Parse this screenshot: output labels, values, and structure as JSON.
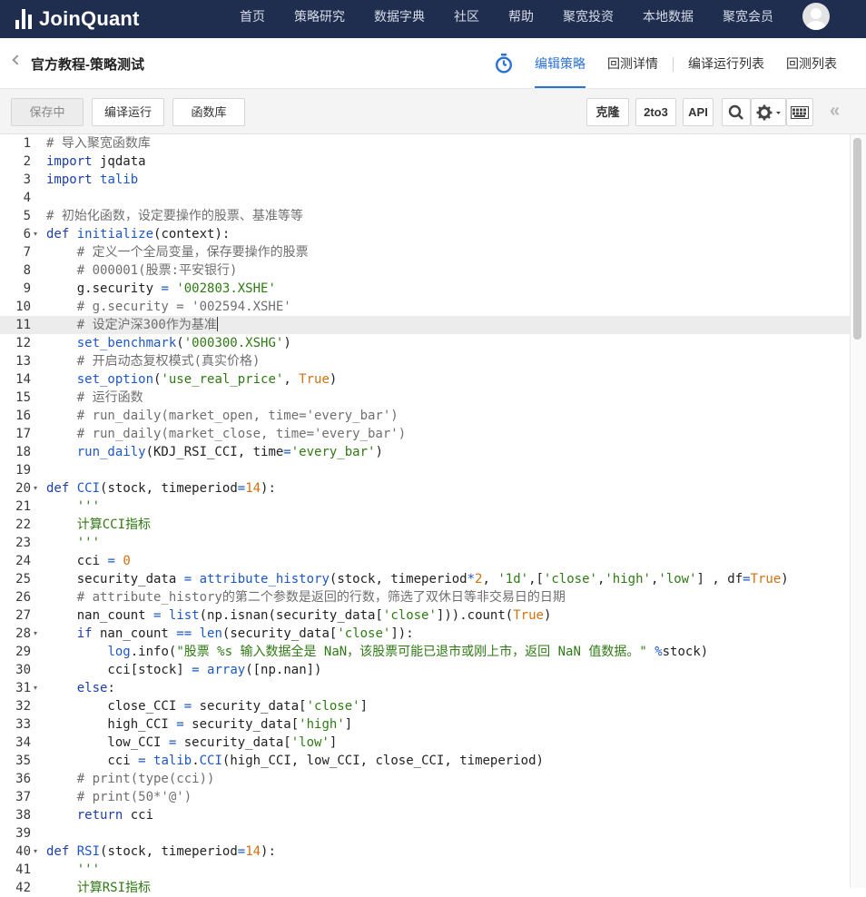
{
  "nav": {
    "logo": "JoinQuant",
    "items": [
      "首页",
      "策略研究",
      "数据字典",
      "社区",
      "帮助",
      "聚宽投资",
      "本地数据",
      "聚宽会员"
    ]
  },
  "header": {
    "title": "官方教程-策略测试",
    "tabs": [
      "编辑策略",
      "回测详情",
      "编译运行列表",
      "回测列表"
    ]
  },
  "toolbar": {
    "save": "保存中",
    "compile_run": "编译运行",
    "library": "函数库",
    "clone": "克隆",
    "to3": "2to3",
    "api": "API"
  },
  "code": {
    "active_line": 11,
    "lines": [
      "# 导入聚宽函数库",
      "import jqdata",
      "import talib",
      "",
      "# 初始化函数，设定要操作的股票、基准等等",
      "def initialize(context):",
      "    # 定义一个全局变量，保存要操作的股票",
      "    # 000001(股票:平安银行)",
      "    g.security = '002803.XSHE'",
      "    # g.security = '002594.XSHE'",
      "    # 设定沪深300作为基准",
      "    set_benchmark('000300.XSHG')",
      "    # 开启动态复权模式(真实价格)",
      "    set_option('use_real_price', True)",
      "    # 运行函数",
      "    # run_daily(market_open, time='every_bar')",
      "    # run_daily(market_close, time='every_bar')",
      "    run_daily(KDJ_RSI_CCI, time='every_bar')",
      "",
      "def CCI(stock, timeperiod=14):",
      "    '''",
      "    计算CCI指标",
      "    '''",
      "    cci = 0",
      "    security_data = attribute_history(stock, timeperiod*2, '1d',['close','high','low'] , df=True)",
      "    # attribute_history的第二个参数是返回的行数，筛选了双休日等非交易日的日期",
      "    nan_count = list(np.isnan(security_data['close'])).count(True)",
      "    if nan_count == len(security_data['close']):",
      "        log.info(\"股票 %s 输入数据全是 NaN，该股票可能已退市或刚上市，返回 NaN 值数据。\" %stock)",
      "        cci[stock] = array([np.nan])",
      "    else:",
      "        close_CCI = security_data['close']",
      "        high_CCI = security_data['high']",
      "        low_CCI = security_data['low']",
      "        cci = talib.CCI(high_CCI, low_CCI, close_CCI, timeperiod)",
      "    # print(type(cci))",
      "    # print(50*'@')",
      "    return cci",
      "",
      "def RSI(stock, timeperiod=14):",
      "    '''",
      "    计算RSI指标"
    ]
  }
}
